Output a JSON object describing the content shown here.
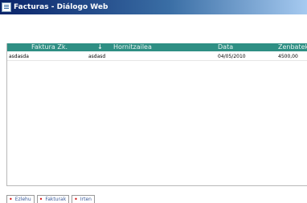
{
  "window": {
    "title": "Facturas - Diálogo Web"
  },
  "grid": {
    "columns": [
      {
        "key": "faktura",
        "label": "Faktura Zk."
      },
      {
        "key": "sort",
        "label": "↓"
      },
      {
        "key": "hornitzailea",
        "label": "Hornitzailea"
      },
      {
        "key": "data",
        "label": "Data"
      },
      {
        "key": "zenbatekoa",
        "label": "Zenbatekoa"
      }
    ],
    "rows": [
      {
        "faktura": "asdasda",
        "hornitzailea": "asdasd",
        "data": "04/05/2010",
        "zenbatekoa": "4500,00"
      }
    ]
  },
  "tabs": [
    {
      "label": "Ezlehu"
    },
    {
      "label": "Fakturak"
    },
    {
      "label": "Irten"
    }
  ],
  "colors": {
    "header_bg": "#2f8f84",
    "title_bar": "#0a246a",
    "tab_mark": "#d01010"
  }
}
